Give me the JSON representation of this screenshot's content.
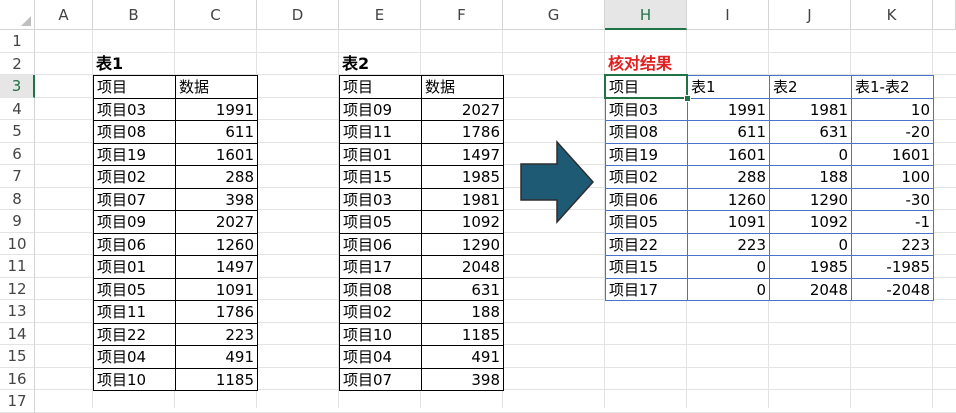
{
  "columns": [
    "A",
    "B",
    "C",
    "D",
    "E",
    "F",
    "G",
    "H",
    "I",
    "J",
    "K"
  ],
  "rows": [
    "1",
    "2",
    "3",
    "4",
    "5",
    "6",
    "7",
    "8",
    "9",
    "10",
    "11",
    "12",
    "13",
    "14",
    "15",
    "16",
    "17"
  ],
  "selected_column": "H",
  "selected_row": "3",
  "table1": {
    "title": "表1",
    "headers": [
      "项目",
      "数据"
    ],
    "rows": [
      [
        "项目03",
        "1991"
      ],
      [
        "项目08",
        "611"
      ],
      [
        "项目19",
        "1601"
      ],
      [
        "项目02",
        "288"
      ],
      [
        "项目07",
        "398"
      ],
      [
        "项目09",
        "2027"
      ],
      [
        "项目06",
        "1260"
      ],
      [
        "项目01",
        "1497"
      ],
      [
        "项目05",
        "1091"
      ],
      [
        "项目11",
        "1786"
      ],
      [
        "项目22",
        "223"
      ],
      [
        "项目04",
        "491"
      ],
      [
        "项目10",
        "1185"
      ]
    ]
  },
  "table2": {
    "title": "表2",
    "headers": [
      "项目",
      "数据"
    ],
    "rows": [
      [
        "项目09",
        "2027"
      ],
      [
        "项目11",
        "1786"
      ],
      [
        "项目01",
        "1497"
      ],
      [
        "项目15",
        "1985"
      ],
      [
        "项目03",
        "1981"
      ],
      [
        "项目05",
        "1092"
      ],
      [
        "项目06",
        "1290"
      ],
      [
        "项目17",
        "2048"
      ],
      [
        "项目08",
        "631"
      ],
      [
        "项目02",
        "188"
      ],
      [
        "项目10",
        "1185"
      ],
      [
        "项目04",
        "491"
      ],
      [
        "项目07",
        "398"
      ]
    ]
  },
  "result": {
    "title": "核对结果",
    "headers": [
      "项目",
      "表1",
      "表2",
      "表1-表2"
    ],
    "rows": [
      [
        "项目03",
        "1991",
        "1981",
        "10"
      ],
      [
        "项目08",
        "611",
        "631",
        "-20"
      ],
      [
        "项目19",
        "1601",
        "0",
        "1601"
      ],
      [
        "项目02",
        "288",
        "188",
        "100"
      ],
      [
        "项目06",
        "1260",
        "1290",
        "-30"
      ],
      [
        "项目05",
        "1091",
        "1092",
        "-1"
      ],
      [
        "项目22",
        "223",
        "0",
        "223"
      ],
      [
        "项目15",
        "0",
        "1985",
        "-1985"
      ],
      [
        "项目17",
        "0",
        "2048",
        "-2048"
      ]
    ]
  },
  "colors": {
    "arrow_fill": "#1f5a75",
    "title_red": "#e02020",
    "selection_green": "#217346",
    "result_border": "#4a74c9"
  }
}
